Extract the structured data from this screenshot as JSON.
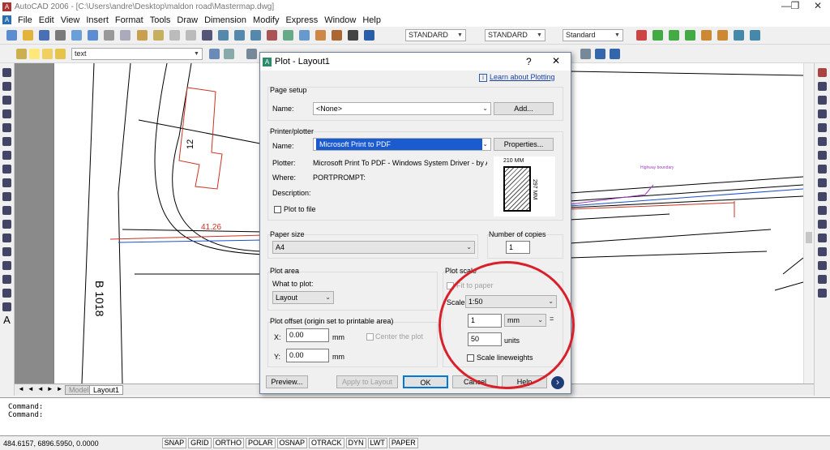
{
  "window": {
    "title": "AutoCAD 2006 - [C:\\Users\\andre\\Desktop\\maldon road\\Mastermap.dwg]",
    "controls": [
      "—",
      "❐",
      "✕"
    ]
  },
  "menu": [
    "File",
    "Edit",
    "View",
    "Insert",
    "Format",
    "Tools",
    "Draw",
    "Dimension",
    "Modify",
    "Express",
    "Window",
    "Help"
  ],
  "toolbar": {
    "textstyle": "STANDARD",
    "dimstyle": "STANDARD",
    "tablestyle": "Standard",
    "layer": "text"
  },
  "drawing": {
    "label_12": "12",
    "label_4126": "41.26",
    "label_b1018": "B 1018",
    "label_hwy": "Highway boundary"
  },
  "tabs": {
    "model": "Model",
    "layout1": "Layout1"
  },
  "command": {
    "line1": "Command:",
    "line2": "Command:"
  },
  "status": {
    "coords": "484.6157,  6896.5950, 0.0000",
    "buttons": [
      "SNAP",
      "GRID",
      "ORTHO",
      "POLAR",
      "OSNAP",
      "OTRACK",
      "DYN",
      "LWT",
      "PAPER"
    ]
  },
  "dialog": {
    "title": "Plot - Layout1",
    "help": "?",
    "close": "✕",
    "learn": "Learn about Plotting",
    "page_setup": {
      "label": "Page setup",
      "name_label": "Name:",
      "name_value": "<None>",
      "add": "Add..."
    },
    "printer": {
      "label": "Printer/plotter",
      "name_label": "Name:",
      "name_value": "Microsoft Print to PDF",
      "properties": "Properties...",
      "plotter_label": "Plotter:",
      "plotter_value": "Microsoft Print To PDF - Windows System Driver - by Au...",
      "where_label": "Where:",
      "where_value": "PORTPROMPT:",
      "desc_label": "Description:",
      "plot_to_file": "Plot to file",
      "paper_w": "210 MM",
      "paper_h": "297 MM"
    },
    "paper_size": {
      "label": "Paper size",
      "value": "A4"
    },
    "copies": {
      "label": "Number of copies",
      "value": "1"
    },
    "plot_area": {
      "label": "Plot area",
      "what_label": "What to plot:",
      "what_value": "Layout"
    },
    "plot_offset": {
      "label": "Plot offset (origin set to printable area)",
      "x_label": "X:",
      "x_value": "0.00",
      "y_label": "Y:",
      "y_value": "0.00",
      "unit": "mm",
      "center": "Center the plot"
    },
    "plot_scale": {
      "label": "Plot scale",
      "fit": "Fit to paper",
      "scale_label": "Scale:",
      "scale_value": "1:50",
      "val1": "1",
      "unit1": "mm",
      "equals": "=",
      "val2": "50",
      "unit2": "units",
      "lineweights": "Scale lineweights"
    },
    "buttons": {
      "preview": "Preview...",
      "apply": "Apply to Layout",
      "ok": "OK",
      "cancel": "Cancel",
      "help": "Help",
      "more": "›"
    }
  }
}
